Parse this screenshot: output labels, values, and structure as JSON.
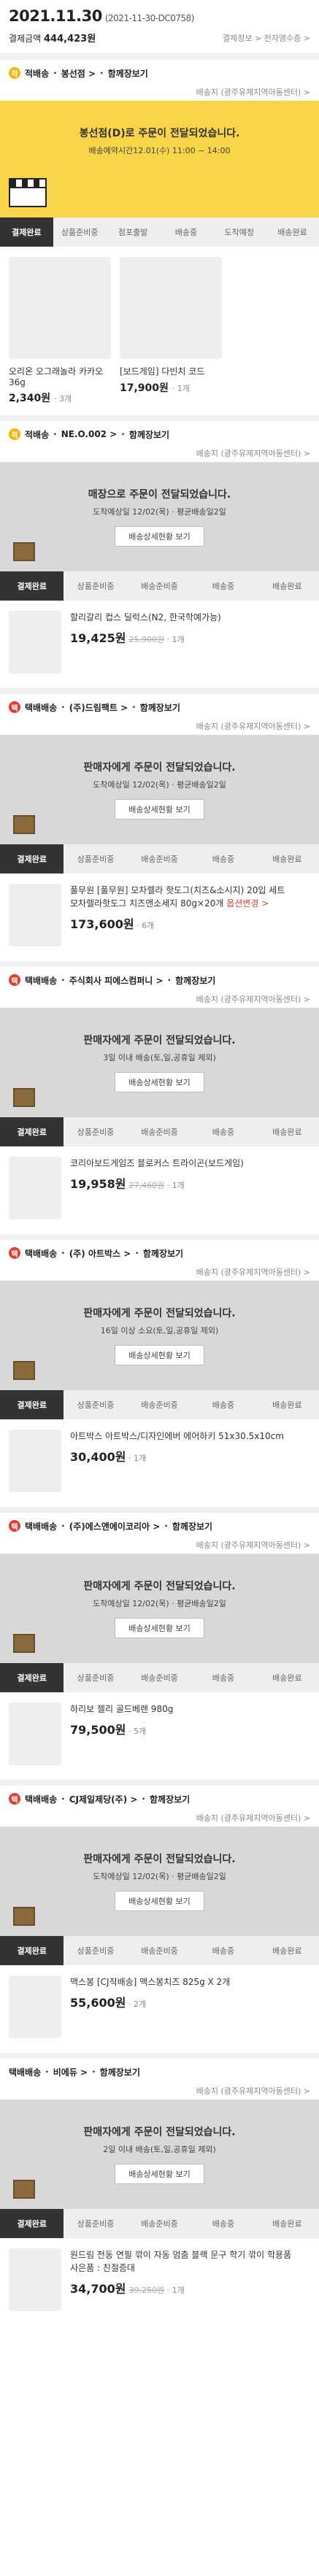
{
  "header": {
    "date": "2021.11.30",
    "order_no": "(2021-11-30-DC0758)",
    "pay_label": "결제금액",
    "pay_amount": "444,423원",
    "links": "결제정보 > 전자영수증 >"
  },
  "sections": [
    {
      "type": "jeok",
      "ship": "적배송",
      "seller": "봉선점",
      "tail": "함께장보기",
      "sub": "배송지 (광주유제지역아동센터) >",
      "banner": {
        "style": "yellow",
        "l1": "봉선점(D)로 주문이 전달되었습니다.",
        "l2": "배송예약시간12.01(수) 11:00 ~ 14:00",
        "btn": ""
      },
      "step_on": 0,
      "products": [
        {
          "name": "오리온 오그래놀라 카카오 36g",
          "price": "2,340원",
          "qty": "· 3개"
        },
        {
          "name": "[보드게임] 다빈치 코드",
          "price": "17,900원",
          "qty": "· 1개"
        }
      ]
    },
    {
      "type": "jeok",
      "ship": "적배송",
      "seller": "NE.O.002",
      "tail": "함께장보기",
      "sub": "배송지 (광주유제지역아동센터) >",
      "banner": {
        "style": "gray",
        "l1": "매장으로 주문이 전달되었습니다.",
        "l2": "도착예상일 12/02(목) · 평균배송일2일",
        "btn": "배송상세현황 보기"
      },
      "step_on": 0,
      "products": [
        {
          "name": "할리갈리 컵스 딜럭스(N2, 한국학예가능)",
          "price": "19,425원",
          "old": "25,900원",
          "qty": "· 1개",
          "opt": ""
        }
      ]
    },
    {
      "type": "tack",
      "ship": "택배배송",
      "seller": "(주)드림팩트",
      "tail": "함께장보기",
      "sub": "배송지 (광주유제지역아동센터) >",
      "banner": {
        "style": "gray",
        "l1": "판매자에게 주문이 전달되었습니다.",
        "l2": "도착예상일 12/02(목) · 평균배송일2일",
        "btn": "배송상세현황 보기"
      },
      "step_on": 0,
      "products": [
        {
          "name": "풀무원 [풀무원] 모차렐라 핫도그(치즈&소시지) 20입 세트",
          "sub": "모차렐라핫도그 치즈앤소세지 80g×20개",
          "opt": "옵션변경 >",
          "price": "173,600원",
          "qty": "· 6개"
        }
      ]
    },
    {
      "type": "tack",
      "ship": "택배배송",
      "seller": "주식회사 피에스컴퍼니",
      "tail": "함께장보기",
      "sub": "배송지 (광주유제지역아동센터) >",
      "banner": {
        "style": "gray",
        "l1": "판매자에게 주문이 전달되었습니다.",
        "l2": "3일 이내 배송(토,일,공휴일 제외)",
        "btn": "배송상세현황 보기"
      },
      "step_on": 0,
      "products": [
        {
          "name": "코리아보드게임즈 블로커스 트라이곤(보드게임)",
          "price": "19,958원",
          "old": "27,460원",
          "qty": "· 1개"
        }
      ]
    },
    {
      "type": "tack",
      "ship": "택배배송",
      "seller": "(주) 아트박스",
      "tail": "함께장보기",
      "sub": "배송지 (광주유제지역아동센터) >",
      "banner": {
        "style": "gray",
        "l1": "판매자에게 주문이 전달되었습니다.",
        "l2": "16일 이상 소요(토,일,공휴일 제외)",
        "btn": "배송상세현황 보기"
      },
      "step_on": 0,
      "products": [
        {
          "name": "아트박스 아트박스/디자인에버 에어하키 51x30.5x10cm",
          "price": "30,400원",
          "qty": "· 1개"
        }
      ]
    },
    {
      "type": "tack",
      "ship": "택배배송",
      "seller": "(주)에스앤에이코리아",
      "tail": "함께장보기",
      "sub": "배송지 (광주유제지역아동센터) >",
      "banner": {
        "style": "gray",
        "l1": "판매자에게 주문이 전달되었습니다.",
        "l2": "도착예상일 12/02(목) · 평균배송일2일",
        "btn": "배송상세현황 보기"
      },
      "step_on": 0,
      "products": [
        {
          "name": "하리보 젤리 골드베렌 980g",
          "price": "79,500원",
          "qty": "· 5개"
        }
      ]
    },
    {
      "type": "tack",
      "ship": "택배배송",
      "seller": "CJ제일제당(주)",
      "tail": "함께장보기",
      "sub": "배송지 (광주유제지역아동센터) >",
      "banner": {
        "style": "gray",
        "l1": "판매자에게 주문이 전달되었습니다.",
        "l2": "도착예상일 12/02(목) · 평균배송일2일",
        "btn": "배송상세현황 보기"
      },
      "step_on": 0,
      "products": [
        {
          "name": "맥스봉 [CJ직배송] 맥스봉치즈 825g X 2개",
          "price": "55,600원",
          "qty": "· 2개"
        }
      ]
    },
    {
      "type": "none",
      "ship": "택배배송",
      "seller": "비에듀",
      "tail": "함께장보기",
      "sub": "배송지 (광주유제지역아동센터) >",
      "banner": {
        "style": "gray",
        "l1": "판매자에게 주문이 전달되었습니다.",
        "l2": "2일 이내 배송(토,일,공휴일 제외)",
        "btn": "배송상세현황 보기"
      },
      "step_on": 0,
      "products": [
        {
          "name": "원드림 전동 연필 깎이 자동 멈춤 블랙 문구 학기 깎이 학용품",
          "sub": "사은품 : 친절증대",
          "price": "34,700원",
          "old": "39,250원",
          "qty": "· 1개"
        }
      ]
    }
  ],
  "steps": [
    "결제완료",
    "상품준비중",
    "배송준비중",
    "배송중",
    "배송완료"
  ],
  "steps_jeok": [
    "결제완료",
    "상품준비중",
    "점포출발",
    "배송중",
    "도착예정",
    "배송완료"
  ]
}
